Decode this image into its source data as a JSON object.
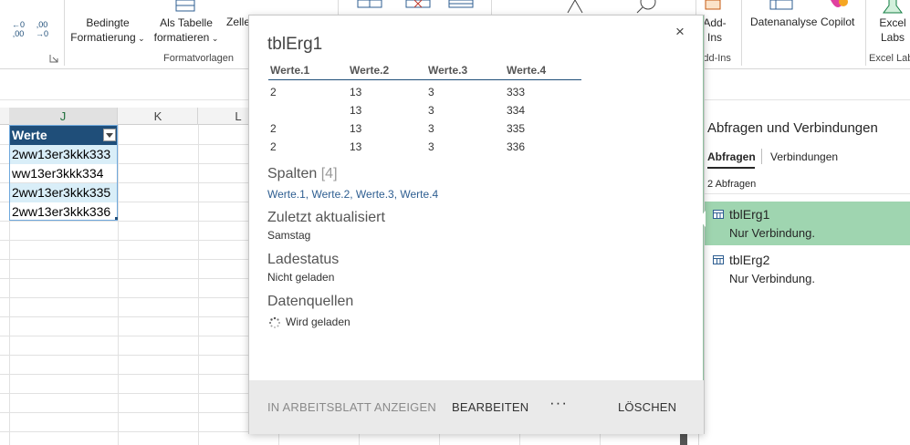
{
  "ribbon": {
    "numfmt_increase": "←0\n,00",
    "numfmt_decrease": ",00\n→0",
    "bedingte_line1": "Bedingte",
    "bedingte_line2": "Formatierung",
    "tabelle_line1": "Als Tabelle",
    "tabelle_line2": "formatieren",
    "zelle_partial": "Zelle",
    "formatvorlagen_label": "Formatvorlagen",
    "addins_line1": "Add-",
    "addins_line2": "Ins",
    "addins_group_label": "Add-Ins",
    "datenanalyse_label": "Datenanalyse",
    "copilot_label": "Copilot",
    "excellabs_line1": "Excel",
    "excellabs_line2": "Labs",
    "excellabs_group_label": "Excel Labs"
  },
  "grid": {
    "columns": [
      "J",
      "K",
      "L"
    ],
    "table_header": "Werte",
    "cells": [
      "2ww13er3kkk333",
      "ww13er3kkk334",
      "2ww13er3kkk335",
      "2ww13er3kkk336"
    ]
  },
  "popup": {
    "title": "tblErg1",
    "close_glyph": "×",
    "table": {
      "headers": [
        "Werte.1",
        "Werte.2",
        "Werte.3",
        "Werte.4"
      ],
      "rows": [
        [
          "2",
          "13",
          "3",
          "333"
        ],
        [
          "",
          "13",
          "3",
          "334"
        ],
        [
          "2",
          "13",
          "3",
          "335"
        ],
        [
          "2",
          "13",
          "3",
          "336"
        ]
      ]
    },
    "spalten_label": "Spalten",
    "spalten_count": "[4]",
    "spalten_list": "Werte.1, Werte.2, Werte.3, Werte.4",
    "updated_label": "Zuletzt aktualisiert",
    "updated_value": "Samstag",
    "load_label": "Ladestatus",
    "load_value": "Nicht geladen",
    "sources_label": "Datenquellen",
    "sources_value": "Wird geladen",
    "footer": {
      "show_in_sheet": "IN ARBEITSBLATT ANZEIGEN",
      "edit": "BEARBEITEN",
      "more": "···",
      "delete": "LÖSCHEN"
    }
  },
  "pane": {
    "title": "Abfragen und Verbindungen",
    "tab_queries": "Abfragen",
    "tab_connections": "Verbindungen",
    "count": "2 Abfragen",
    "queries": [
      {
        "name": "tblErg1",
        "status": "Nur Verbindung."
      },
      {
        "name": "tblErg2",
        "status": "Nur Verbindung."
      }
    ]
  },
  "colors": {
    "table_header_bg": "#1f4e79",
    "table_band_bg": "#d9eef8",
    "selected_query_bg": "#9fd5b0",
    "link_blue": "#2e5e91"
  }
}
